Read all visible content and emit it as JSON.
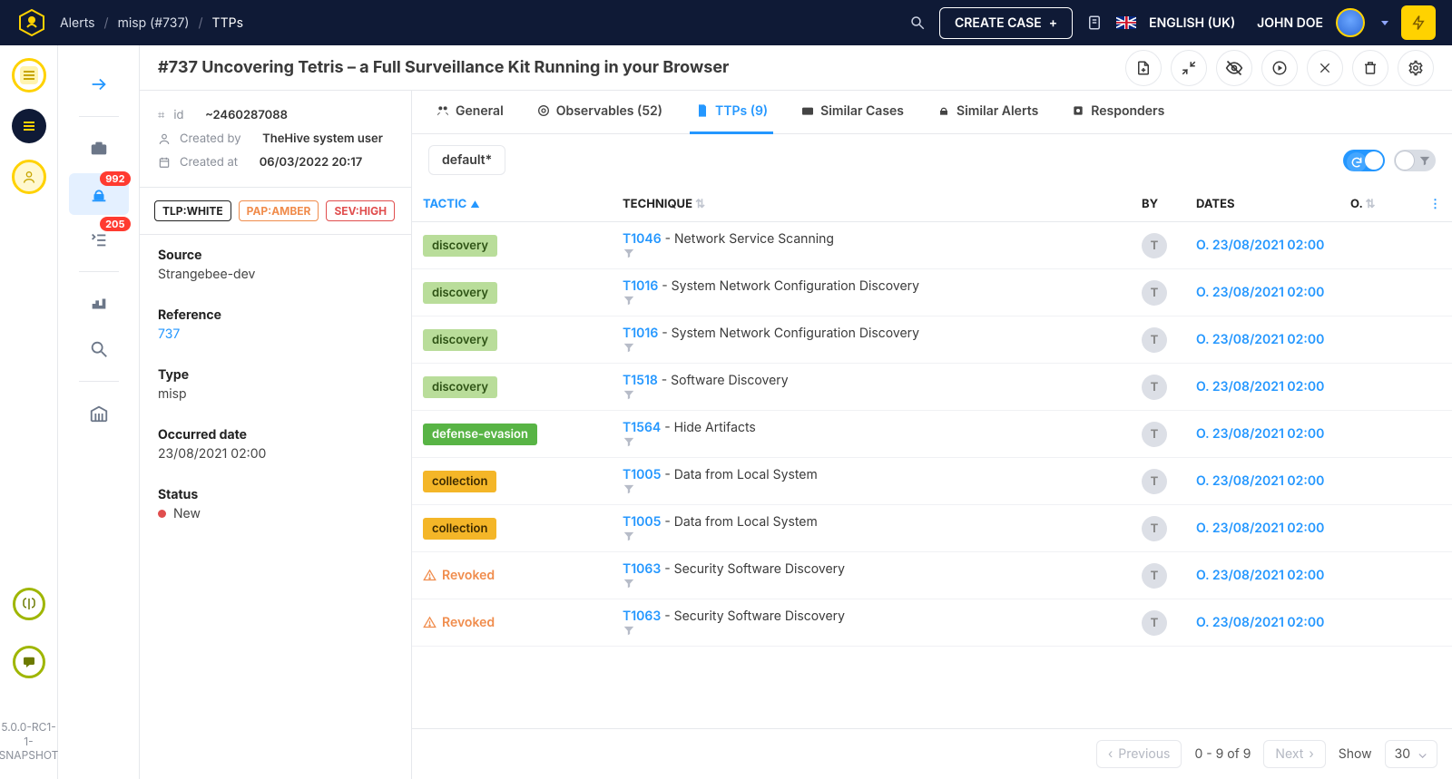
{
  "breadcrumb": {
    "a": "Alerts",
    "b": "misp (#737)",
    "c": "TTPs"
  },
  "topbar": {
    "create_case": "CREATE CASE",
    "lang": "ENGLISH (UK)",
    "user": "JOHN DOE"
  },
  "navbadges": {
    "alerts": "992",
    "tasks": "205"
  },
  "version_line1": "5.0.0-RC1-",
  "version_line2": "1-",
  "version_line3": "SNAPSHOT",
  "title": "#737 Uncovering Tetris – a Full Surveillance Kit Running in your Browser",
  "meta": {
    "id_label": "id",
    "id_value": "~2460287088",
    "createdby_label": "Created by",
    "createdby_value": "TheHive system user",
    "createdat_label": "Created at",
    "createdat_value": "06/03/2022 20:17"
  },
  "tags": {
    "tlp": "TLP:WHITE",
    "pap": "PAP:AMBER",
    "sev": "SEV:HIGH"
  },
  "side": {
    "source_k": "Source",
    "source_v": "Strangebee-dev",
    "ref_k": "Reference",
    "ref_v": "737",
    "type_k": "Type",
    "type_v": "misp",
    "occ_k": "Occurred date",
    "occ_v": "23/08/2021 02:00",
    "status_k": "Status",
    "status_v": "New"
  },
  "tabs": {
    "general": "General",
    "observables": "Observables (52)",
    "ttps": "TTPs (9)",
    "similar_cases": "Similar Cases",
    "similar_alerts": "Similar Alerts",
    "responders": "Responders"
  },
  "filter_default": "default*",
  "columns": {
    "tactic": "TACTIC",
    "technique": "TECHNIQUE",
    "by": "BY",
    "dates": "DATES",
    "o": "O."
  },
  "sep": " - ",
  "revoked_label": "Revoked",
  "by_initial": "T",
  "rows": [
    {
      "tactic": "discovery",
      "tactic_cls": "discovery",
      "tid": "T1046",
      "tname": "Network Service Scanning",
      "date": "O. 23/08/2021 02:00"
    },
    {
      "tactic": "discovery",
      "tactic_cls": "discovery",
      "tid": "T1016",
      "tname": "System Network Configuration Discovery",
      "date": "O. 23/08/2021 02:00"
    },
    {
      "tactic": "discovery",
      "tactic_cls": "discovery",
      "tid": "T1016",
      "tname": "System Network Configuration Discovery",
      "date": "O. 23/08/2021 02:00"
    },
    {
      "tactic": "discovery",
      "tactic_cls": "discovery",
      "tid": "T1518",
      "tname": "Software Discovery",
      "date": "O. 23/08/2021 02:00"
    },
    {
      "tactic": "defense-evasion",
      "tactic_cls": "defense-evasion",
      "tid": "T1564",
      "tname": "Hide Artifacts",
      "date": "O. 23/08/2021 02:00"
    },
    {
      "tactic": "collection",
      "tactic_cls": "collection",
      "tid": "T1005",
      "tname": "Data from Local System",
      "date": "O. 23/08/2021 02:00"
    },
    {
      "tactic": "collection",
      "tactic_cls": "collection",
      "tid": "T1005",
      "tname": "Data from Local System",
      "date": "O. 23/08/2021 02:00"
    },
    {
      "tactic": "Revoked",
      "tactic_cls": "revoked",
      "tid": "T1063",
      "tname": "Security Software Discovery",
      "date": "O. 23/08/2021 02:00"
    },
    {
      "tactic": "Revoked",
      "tactic_cls": "revoked",
      "tid": "T1063",
      "tname": "Security Software Discovery",
      "date": "O. 23/08/2021 02:00"
    }
  ],
  "pager": {
    "prev": "Previous",
    "range": "0 - 9 of 9",
    "next": "Next",
    "show": "Show",
    "size": "30"
  }
}
